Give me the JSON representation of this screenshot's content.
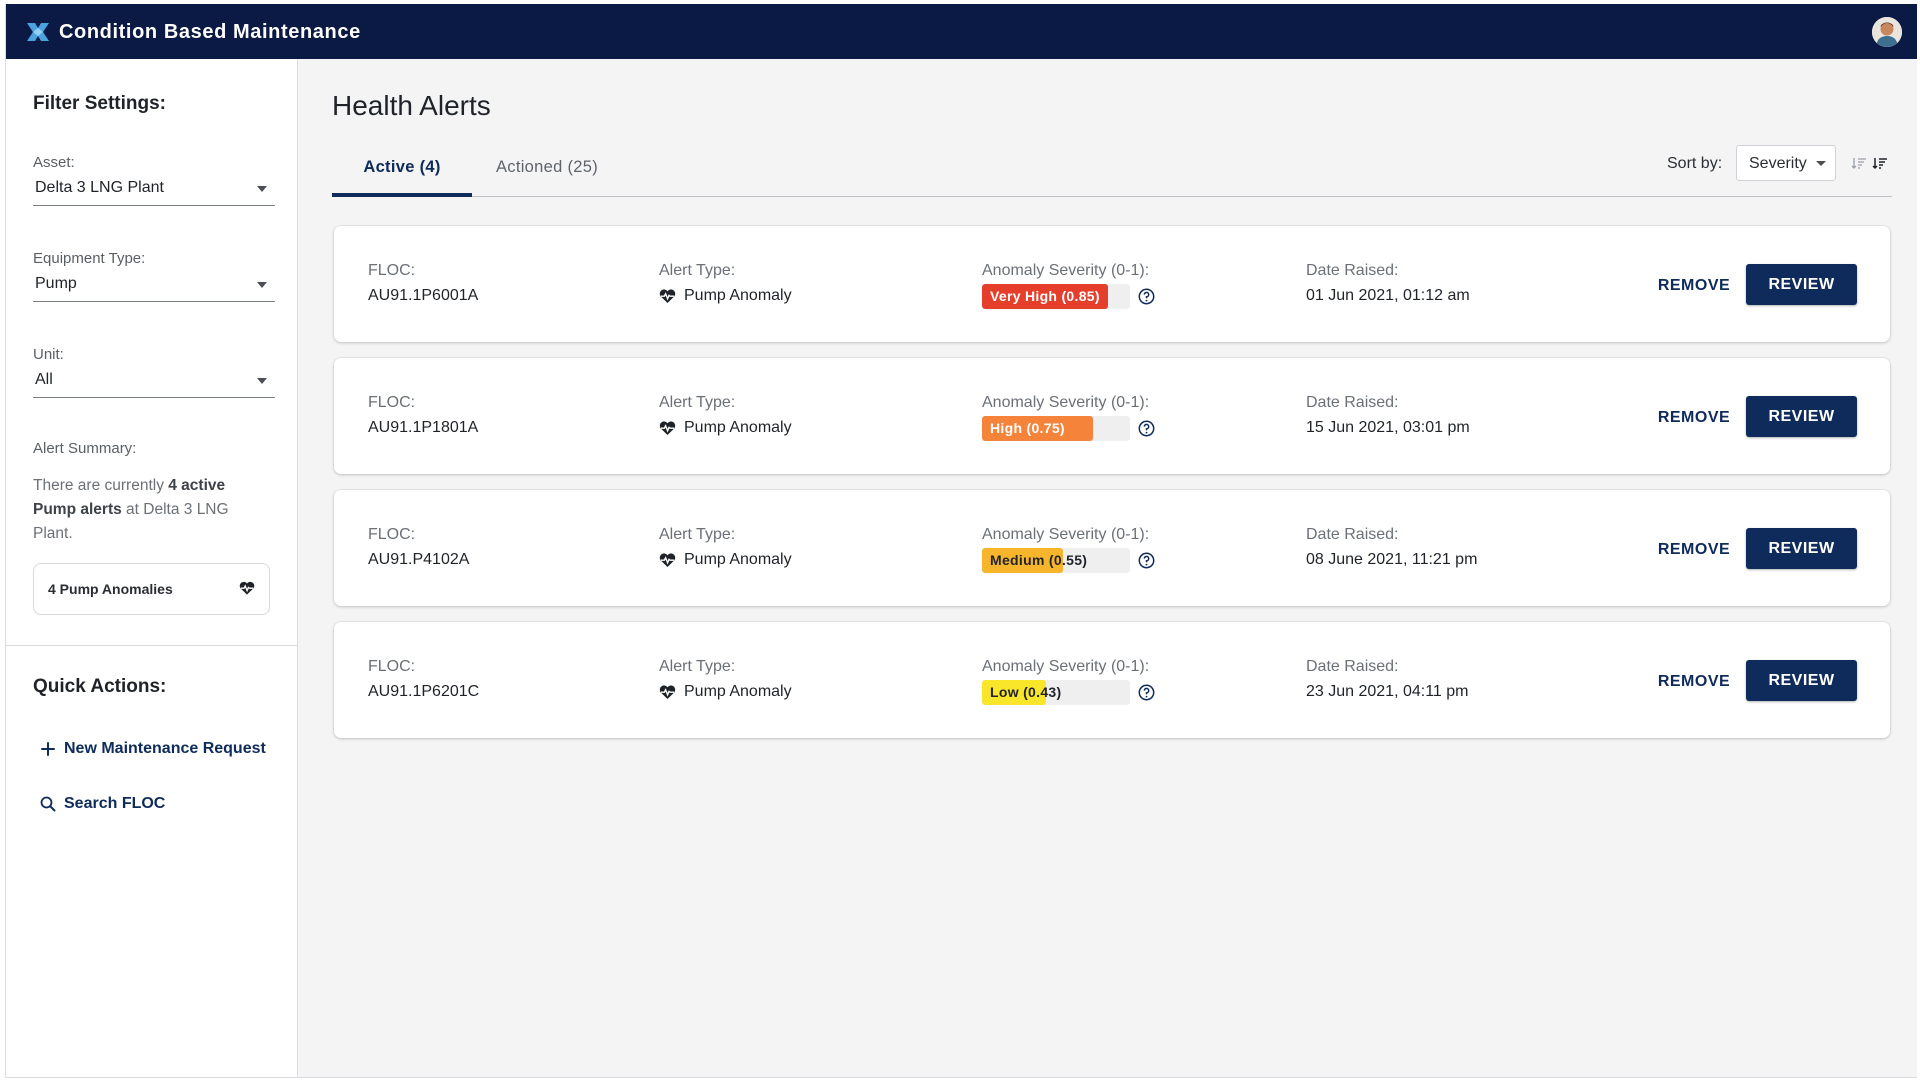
{
  "app": {
    "title": "Condition Based Maintenance"
  },
  "colors": {
    "navy": "#0b1a45",
    "primary": "#0e2b5c",
    "very_high": "#e53e2b",
    "high": "#f5833a",
    "medium": "#f7b52b",
    "low": "#f9e52a"
  },
  "sidebar": {
    "filter_heading": "Filter Settings:",
    "asset": {
      "label": "Asset:",
      "value": "Delta 3 LNG Plant"
    },
    "equipment_type": {
      "label": "Equipment Type:",
      "value": "Pump"
    },
    "unit": {
      "label": "Unit:",
      "value": "All"
    },
    "alert_summary": {
      "label": "Alert Summary:",
      "text_prefix": "There are currently ",
      "count_text": "4 active",
      "pump_text": "Pump alerts",
      "text_suffix": " at Delta 3 LNG Plant."
    },
    "chip": {
      "label": "4 Pump Anomalies",
      "icon": "heart-pulse-icon"
    },
    "quick_actions_heading": "Quick Actions:",
    "quick_actions": [
      {
        "label": "New Maintenance Request",
        "icon": "plus-icon"
      },
      {
        "label": "Search FLOC",
        "icon": "search-icon"
      }
    ]
  },
  "main": {
    "title": "Health Alerts",
    "tabs": [
      {
        "label": "Active (4)",
        "active": true
      },
      {
        "label": "Actioned (25)",
        "active": false
      }
    ],
    "sort": {
      "label": "Sort by:",
      "value": "Severity"
    },
    "labels": {
      "floc": "FLOC:",
      "alert_type": "Alert Type:",
      "severity": "Anomaly Severity (0-1):",
      "date": "Date Raised:",
      "remove": "REMOVE",
      "review": "REVIEW"
    },
    "alerts": [
      {
        "floc": "AU91.1P6001A",
        "alert_type": "Pump Anomaly",
        "severity_text": "Very High (0.85)",
        "severity": 0.85,
        "color": "#e53e2b",
        "text_color": "#ffffff",
        "date": "01 Jun 2021, 01:12 am"
      },
      {
        "floc": "AU91.1P1801A",
        "alert_type": "Pump Anomaly",
        "severity_text": "High (0.75)",
        "severity": 0.75,
        "color": "#f5833a",
        "text_color": "#ffffff",
        "date": "15 Jun 2021, 03:01 pm"
      },
      {
        "floc": "AU91.P4102A",
        "alert_type": "Pump Anomaly",
        "severity_text": "Medium (0.55)",
        "severity": 0.55,
        "color": "#f7b52b",
        "text_color": "#1f2329",
        "date": "08 June 2021, 11:21 pm"
      },
      {
        "floc": "AU91.1P6201C",
        "alert_type": "Pump Anomaly",
        "severity_text": "Low (0.43)",
        "severity": 0.43,
        "color": "#f9e52a",
        "text_color": "#1f2329",
        "date": "23 Jun 2021, 04:11 pm"
      }
    ]
  }
}
